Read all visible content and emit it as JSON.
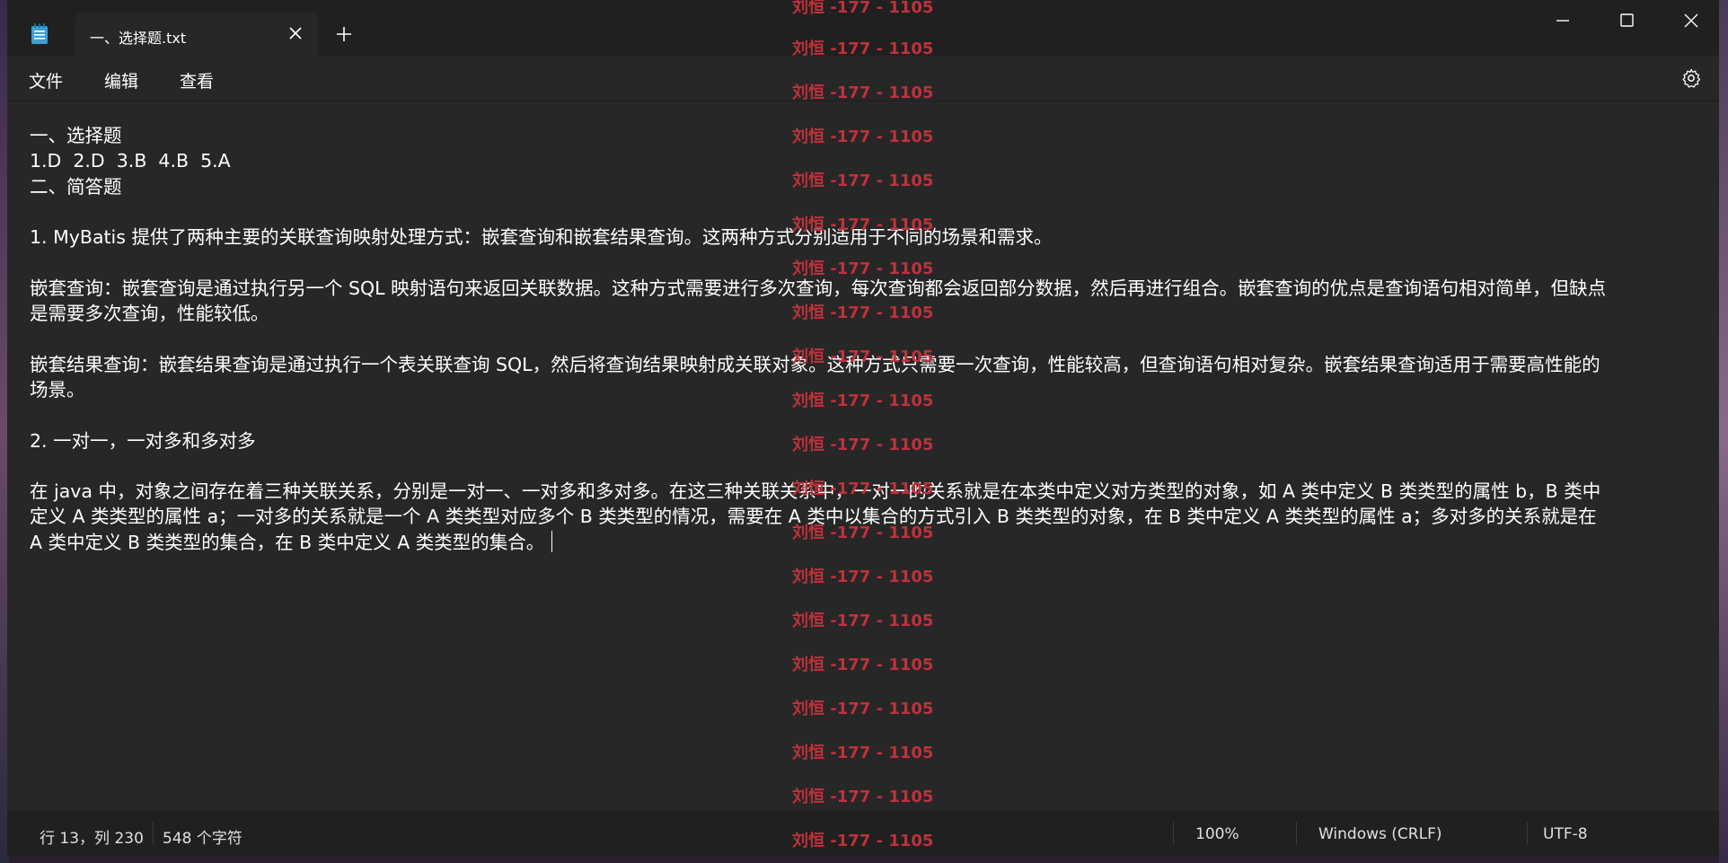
{
  "tab": {
    "title": "一、选择题.txt",
    "new_tab_symbol": "+"
  },
  "menu": {
    "file": "文件",
    "edit": "编辑",
    "view": "查看"
  },
  "icons": {
    "app": "notepad-icon",
    "close_tab": "close-icon",
    "new_tab": "plus-icon",
    "minimize": "minimize-icon",
    "maximize": "maximize-icon",
    "close_window": "close-icon",
    "settings": "gear-icon"
  },
  "document": {
    "lines": [
      "一、选择题",
      "1.D  2.D  3.B  4.B  5.A",
      "二、简答题",
      "",
      "1. MyBatis 提供了两种主要的关联查询映射处理方式：嵌套查询和嵌套结果查询。这两种方式分别适用于不同的场景和需求。",
      "",
      "嵌套查询：嵌套查询是通过执行另一个 SQL 映射语句来返回关联数据。这种方式需要进行多次查询，每次查询都会返回部分数据，然后再进行组合。嵌套查询的优点是查询语句相对简单，但缺点",
      "是需要多次查询，性能较低。",
      "",
      "嵌套结果查询：嵌套结果查询是通过执行一个表关联查询 SQL，然后将查询结果映射成关联对象。这种方式只需要一次查询，性能较高，但查询语句相对复杂。嵌套结果查询适用于需要高性能的",
      "场景。",
      "",
      "2. 一对一，一对多和多对多",
      "",
      "在 java 中，对象之间存在着三种关联关系，分别是一对一、一对多和多对多。在这三种关联关系中，一对一的关系就是在本类中定义对方类型的对象，如 A 类中定义 B 类类型的属性 b，B 类中",
      "定义 A 类类型的属性 a；一对多的关系就是一个 A 类类型对应多个 B 类类型的情况，需要在 A 类中以集合的方式引入 B 类类型的对象，在 B 类中定义 A 类类型的属性 a；多对多的关系就是在",
      "A 类中定义 B 类类型的集合，在 B 类中定义 A 类类型的集合。"
    ]
  },
  "status": {
    "position": "行 13，列 230",
    "char_count": "548 个字符",
    "zoom": "100%",
    "line_ending": "Windows (CRLF)",
    "encoding": "UTF-8"
  },
  "watermark": {
    "text": "刘恒 -177 - 1105",
    "color": "#c0313b"
  },
  "colors": {
    "editor_bg": "#272727",
    "titlebar_bg": "#202020",
    "text": "#ffffff"
  }
}
